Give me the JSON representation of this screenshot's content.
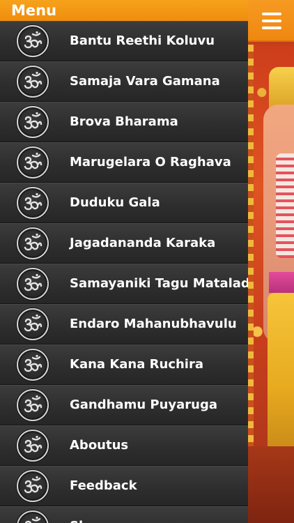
{
  "header": {
    "title": "Menu",
    "menu_button_icon": "hamburger-menu-icon",
    "accent_color": "#f29414"
  },
  "menu": {
    "item_icon": "om-symbol-icon",
    "items": [
      {
        "label": "Bantu Reethi Koluvu"
      },
      {
        "label": "Samaja Vara Gamana"
      },
      {
        "label": "Brova Bharama"
      },
      {
        "label": "Marugelara O Raghava"
      },
      {
        "label": "Duduku Gala"
      },
      {
        "label": "Jagadananda Karaka"
      },
      {
        "label": "Samayaniki Tagu Matalade"
      },
      {
        "label": "Endaro Mahanubhavulu"
      },
      {
        "label": "Kana Kana Ruchira"
      },
      {
        "label": "Gandhamu Puyaruga"
      },
      {
        "label": "Aboutus"
      },
      {
        "label": "Feedback"
      },
      {
        "label": "Share"
      }
    ]
  },
  "background_image": {
    "subject": "devotional-deity-artwork"
  }
}
